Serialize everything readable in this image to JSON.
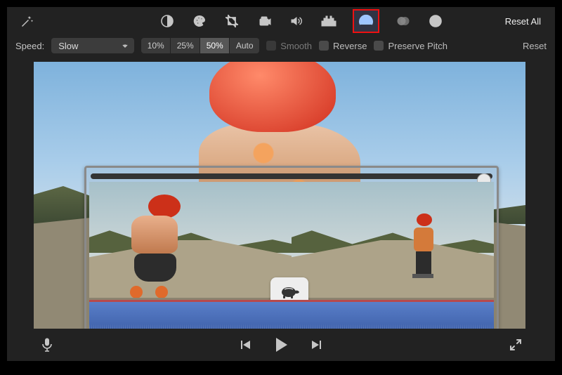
{
  "toolbar": {
    "reset_all": "Reset All"
  },
  "speed": {
    "label": "Speed:",
    "selected": "Slow",
    "presets": [
      "10%",
      "25%",
      "50%",
      "Auto"
    ],
    "active_preset_index": 2,
    "smooth_label": "Smooth",
    "reverse_label": "Reverse",
    "preserve_pitch_label": "Preserve Pitch",
    "reset": "Reset"
  },
  "icons": {
    "magic": "magic-wand-icon",
    "contrast": "contrast-icon",
    "palette": "palette-icon",
    "crop": "crop-icon",
    "camera": "stabilization-icon",
    "volume": "volume-icon",
    "equalizer": "equalizer-icon",
    "speedometer": "speedometer-icon",
    "overlap": "overlap-icon",
    "info": "info-icon"
  }
}
